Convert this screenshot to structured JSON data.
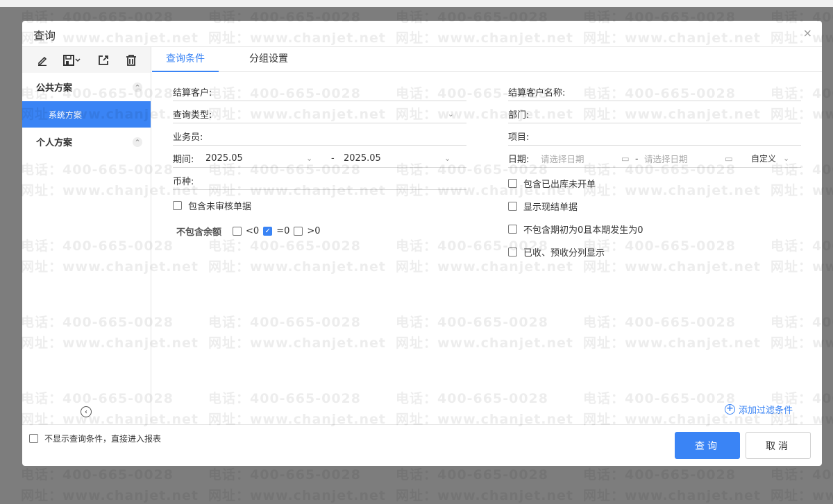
{
  "dialog": {
    "title": "查询",
    "close": "×"
  },
  "sidebar": {
    "groups": [
      {
        "label": "公共方案",
        "items": [
          "系统方案"
        ]
      },
      {
        "label": "个人方案",
        "items": []
      }
    ]
  },
  "tabs": [
    "查询条件",
    "分组设置"
  ],
  "left": {
    "settle_customer": "结算客户:",
    "query_type": "查询类型:",
    "salesman": "业务员:",
    "period_label": "期间:",
    "period_from": "2025.05",
    "period_sep": "-",
    "period_to": "2025.05",
    "currency": "币种:",
    "include_unaudited": "包含未审核单据",
    "exclude_balance": "不包含余额",
    "lt0": "<0",
    "eq0": "=0",
    "gt0": ">0"
  },
  "right": {
    "customer_name": "结算客户名称:",
    "department": "部门:",
    "project": "项目:",
    "date_label": "日期:",
    "date_from_placeholder": "请选择日期",
    "date_sep": "-",
    "date_to_placeholder": "请选择日期",
    "date_mode": "自定义",
    "opt1": "包含已出库未开单",
    "opt2": "显示现结单据",
    "opt3": "不包含期初为0且本期发生为0",
    "opt4": "已收、预收分列显示"
  },
  "add_filter": "添加过滤条件",
  "footer": {
    "skip": "不显示查询条件，直接进入报表",
    "query": "查询",
    "cancel": "取消"
  },
  "watermark": {
    "phone": "电话：400-665-0028",
    "site": "网址：www.chanjet.net"
  },
  "colors": {
    "accent": "#3a84f5"
  }
}
